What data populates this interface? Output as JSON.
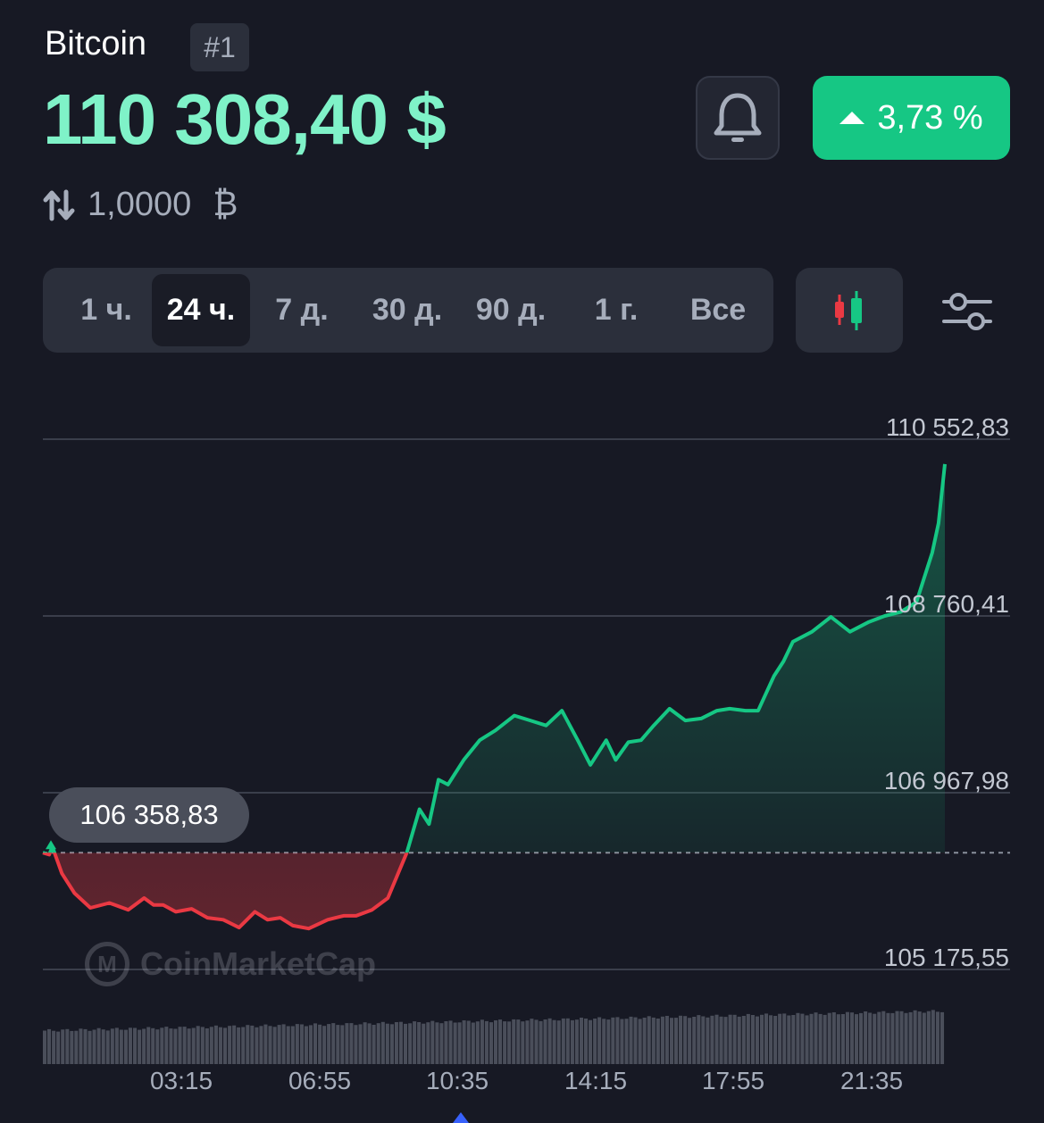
{
  "coin": {
    "name": "Bitcoin",
    "rank": "#1"
  },
  "price": "110 308,40 $",
  "change": {
    "text": "3,73 %",
    "direction": "up",
    "color": "#16c784"
  },
  "amount": {
    "value": "1,0000",
    "symbol": "₿"
  },
  "icons": {
    "bell": "bell-icon",
    "swap": "swap-arrows-icon",
    "candles": "candlestick-icon",
    "filter": "sliders-icon",
    "caret": "caret-up-icon"
  },
  "tabs": [
    {
      "label": "1 ч.",
      "active": false
    },
    {
      "label": "24 ч.",
      "active": true
    },
    {
      "label": "7 д.",
      "active": false
    },
    {
      "label": "30 д.",
      "active": false
    },
    {
      "label": "90 д.",
      "active": false
    },
    {
      "label": "1 г.",
      "active": false
    },
    {
      "label": "Все",
      "active": false
    }
  ],
  "chart_data": {
    "type": "line",
    "baseline": 106358.83,
    "baseline_label": "106 358,83",
    "y_tick_labels": [
      "110 552,83",
      "108 760,41",
      "106 967,98",
      "105 175,55"
    ],
    "y_ticks": [
      110552.83,
      108760.41,
      106967.98,
      105175.55
    ],
    "ylim": [
      105175.55,
      110552.83
    ],
    "x_tick_labels": [
      "03:15",
      "06:55",
      "10:35",
      "14:15",
      "17:55",
      "21:35"
    ],
    "x_ticks_minutes": [
      195,
      415,
      635,
      855,
      1075,
      1295
    ],
    "x_range_minutes": [
      15,
      1440
    ],
    "colors": {
      "up": "#16c784",
      "down": "#ea3943"
    },
    "watermark": "CoinMarketCap",
    "series": [
      {
        "x": [
          15,
          25,
          30,
          45,
          65,
          90,
          120,
          150,
          175,
          190,
          205,
          225,
          250,
          275,
          300,
          325,
          350,
          370,
          390,
          410,
          435,
          465,
          490,
          510,
          535,
          560,
          590,
          610,
          625,
          640,
          655,
          680,
          705,
          730,
          760,
          785,
          810,
          835,
          860,
          880,
          905,
          920,
          940,
          960,
          980,
          1005,
          1030,
          1055,
          1080,
          1100,
          1125,
          1145,
          1170,
          1185,
          1200,
          1230,
          1260,
          1290,
          1320,
          1345,
          1370,
          1395,
          1420,
          1430,
          1440
        ],
        "values": [
          106360,
          106340,
          106420,
          106150,
          105950,
          105800,
          105850,
          105780,
          105900,
          105830,
          105830,
          105760,
          105790,
          105700,
          105680,
          105600,
          105760,
          105680,
          105700,
          105620,
          105590,
          105680,
          105720,
          105720,
          105780,
          105900,
          106360,
          106800,
          106650,
          107100,
          107050,
          107300,
          107500,
          107600,
          107750,
          107700,
          107650,
          107800,
          107500,
          107250,
          107500,
          107300,
          107480,
          107500,
          107650,
          107820,
          107700,
          107720,
          107800,
          107820,
          107800,
          107800,
          108150,
          108300,
          108500,
          108600,
          108750,
          108600,
          108700,
          108760,
          108800,
          108900,
          109400,
          109700,
          110300
        ]
      }
    ]
  }
}
